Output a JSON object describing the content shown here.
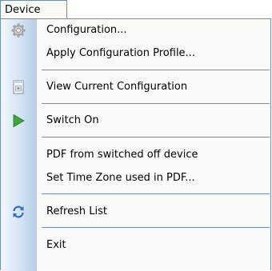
{
  "menubar": {
    "device_label": "Device"
  },
  "menu": {
    "configuration": "Configuration...",
    "apply_profile": "Apply Configuration Profile...",
    "view_current": "View Current Configuration",
    "switch_on": "Switch On",
    "pdf_from_off": "PDF from switched off device",
    "set_time_zone": "Set Time Zone used in PDF...",
    "refresh_list": "Refresh List",
    "exit": "Exit"
  },
  "icons": {
    "configuration": "gear-icon",
    "view_current": "document-icon",
    "switch_on": "play-icon",
    "refresh_list": "refresh-icon"
  },
  "colors": {
    "border": "#6f8fb5",
    "play_green": "#3aa838",
    "refresh_blue": "#2f6fc2"
  }
}
